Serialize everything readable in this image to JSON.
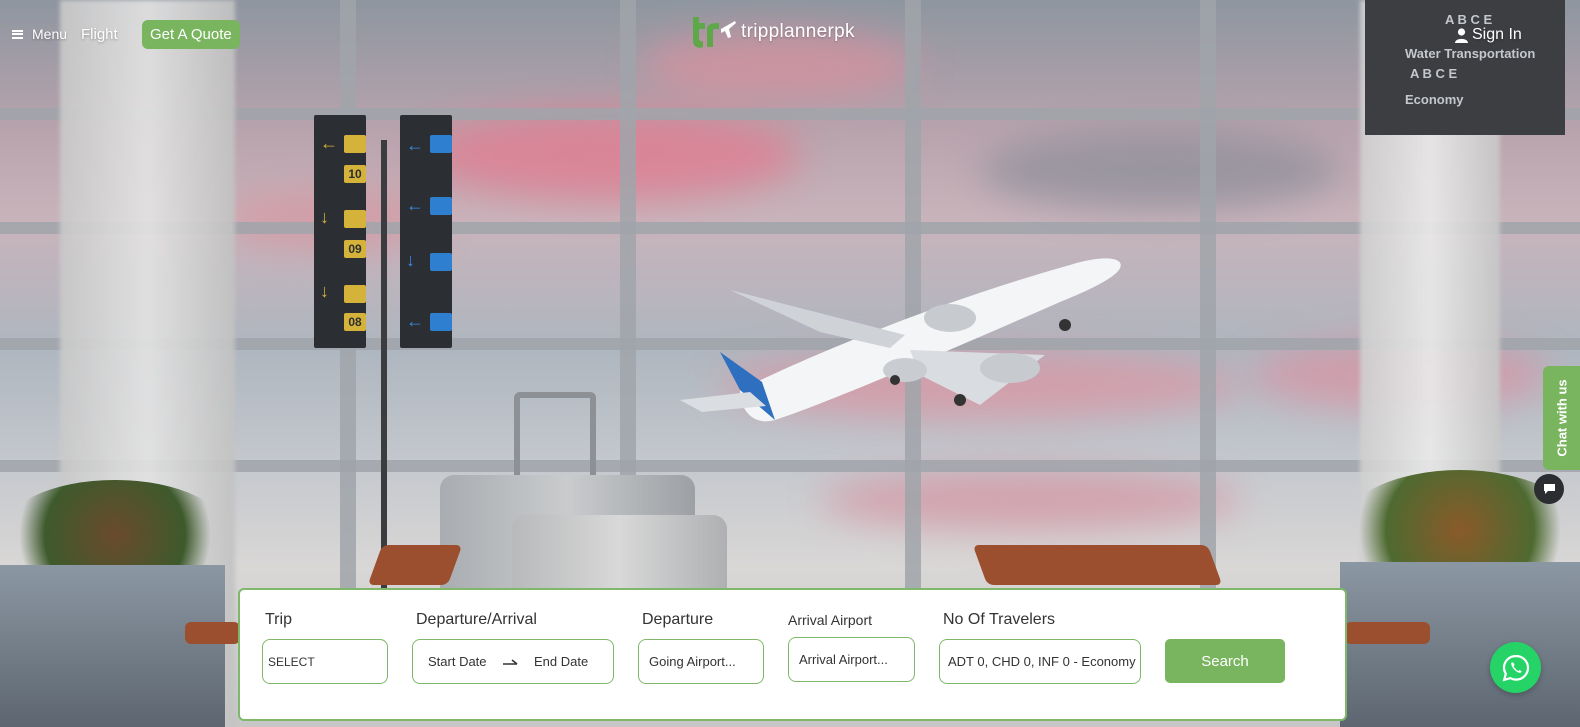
{
  "header": {
    "menu_label": "Menu",
    "nav_flight": "Flight",
    "quote_button": "Get A Quote",
    "logo_text": "tripplannerpk",
    "sign_in": "Sign In"
  },
  "background": {
    "signs": {
      "gate_numbers": [
        "10",
        "09",
        "08"
      ]
    },
    "board": {
      "line1": "A B C E",
      "line2": "Water Transportation",
      "line3": "A B C E",
      "line4": "Economy"
    }
  },
  "chat": {
    "tab_label": "Chat with us"
  },
  "search": {
    "trip_label": "Trip",
    "trip_value": "SELECT",
    "dates_label": "Departure/Arrival",
    "start_date_placeholder": "Start Date",
    "end_date_placeholder": "End Date",
    "departure_label": "Departure",
    "departure_placeholder": "Going Airport...",
    "arrival_label": "Arrival Airport",
    "arrival_placeholder": "Arrival Airport...",
    "travelers_label": "No Of Travelers",
    "travelers_value": "ADT 0, CHD 0, INF 0 - Economy",
    "search_button": "Search"
  },
  "colors": {
    "accent_green": "#79b45f",
    "border_green": "#7fb86a",
    "whatsapp_green": "#25d366"
  }
}
